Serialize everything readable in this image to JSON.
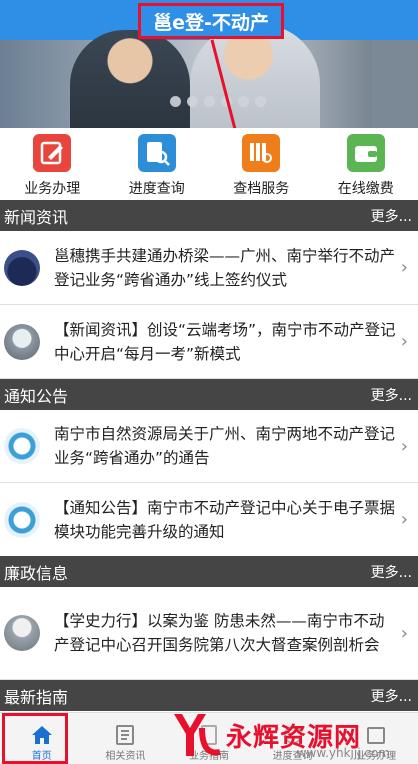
{
  "app": {
    "title": "邕e登-不动产"
  },
  "quick_menu": [
    {
      "label": "业务办理",
      "icon": "edit-document-icon",
      "color": "#e8453c"
    },
    {
      "label": "进度查询",
      "icon": "search-document-icon",
      "color": "#2d8ed8"
    },
    {
      "label": "查档服务",
      "icon": "archive-search-icon",
      "color": "#ef7d1a"
    },
    {
      "label": "在线缴费",
      "icon": "wallet-icon",
      "color": "#5ab552"
    }
  ],
  "sections": {
    "news": {
      "title": "新闻资讯",
      "more": "更多..."
    },
    "notice": {
      "title": "通知公告",
      "more": "更多..."
    },
    "integrity": {
      "title": "廉政信息",
      "more": "更多..."
    },
    "guide": {
      "title": "最新指南",
      "more": "更多..."
    }
  },
  "news_items": [
    {
      "title": "邕穗携手共建通办桥梁——广州、南宁举行不动产登记业务“跨省通办”线上签约仪式"
    },
    {
      "title": "【新闻资讯】创设“云端考场”，南宁市不动产登记中心开启“每月一考”新模式"
    }
  ],
  "notice_items": [
    {
      "title": "南宁市自然资源局关于广州、南宁两地不动产登记业务“跨省通办”的通告"
    },
    {
      "title": "【通知公告】南宁市不动产登记中心关于电子票据模块功能完善升级的通知"
    }
  ],
  "integrity_items": [
    {
      "title": "【学史力行】以案为鉴 防患未然——南宁市不动产登记中心召开国务院第八次大督查案例剖析会"
    }
  ],
  "bottom_nav": [
    {
      "label": "首页",
      "icon": "home-icon"
    },
    {
      "label": "相关资讯",
      "icon": "news-icon"
    },
    {
      "label": "业务指南",
      "icon": "guide-icon"
    },
    {
      "label": "进度查询",
      "icon": "progress-icon"
    },
    {
      "label": "业务办理",
      "icon": "business-icon"
    }
  ],
  "watermark": {
    "text": "永辉资源网",
    "url": "www.yhkjjj.com"
  },
  "colors": {
    "accent": "#2f8fe6",
    "section_bar": "#454545",
    "highlight_red": "#e8112d",
    "active_nav": "#1b6fd1"
  }
}
